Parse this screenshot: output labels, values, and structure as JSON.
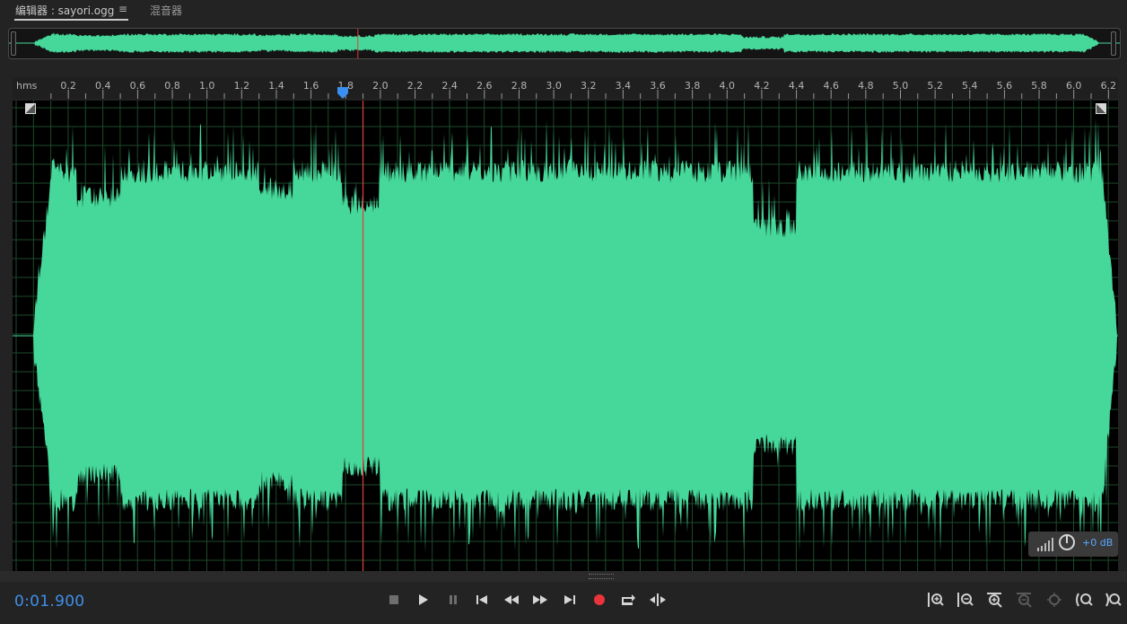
{
  "tabs": [
    {
      "label": "编辑器 : sayori.ogg",
      "active": true
    },
    {
      "label": "混音器",
      "active": false
    }
  ],
  "menu_icon": "hamburger-menu-icon",
  "ruler": {
    "unit_label": "hms",
    "ticks": [
      "0.2",
      "0.4",
      "0.6",
      "0.8",
      "1.0",
      "1.2",
      "1.4",
      "1.6",
      "1.8",
      "2.0",
      "2.2",
      "2.4",
      "2.6",
      "2.8",
      "3.0",
      "3.2",
      "3.4",
      "3.6",
      "3.8",
      "4.0",
      "4.2",
      "4.4",
      "4.6",
      "4.8",
      "5.0",
      "5.2",
      "5.4",
      "5.6",
      "5.8",
      "6.0",
      "6.2"
    ]
  },
  "waveform": {
    "color": "#46d89a",
    "playhead_color": "#e23b3b",
    "grid_color": "#1e4a2a",
    "duration_seconds": 6.3,
    "playhead_seconds": 1.9
  },
  "gain": {
    "label": "+0 dB",
    "icons": [
      "level-bars-icon",
      "gain-knob-icon"
    ]
  },
  "transport": {
    "timecode": "0:01.900",
    "buttons": [
      {
        "name": "stop-button",
        "icon": "stop-icon"
      },
      {
        "name": "play-button",
        "icon": "play-icon"
      },
      {
        "name": "pause-button",
        "icon": "pause-icon"
      },
      {
        "name": "skip-to-start-button",
        "icon": "skip-start-icon"
      },
      {
        "name": "rewind-button",
        "icon": "rewind-icon"
      },
      {
        "name": "fast-forward-button",
        "icon": "fast-forward-icon"
      },
      {
        "name": "skip-to-end-button",
        "icon": "skip-end-icon"
      },
      {
        "name": "record-button",
        "icon": "record-icon"
      },
      {
        "name": "loop-button",
        "icon": "loop-icon"
      },
      {
        "name": "skip-selection-button",
        "icon": "skip-selection-icon"
      }
    ],
    "zoom_buttons": [
      {
        "name": "zoom-in-amplitude-button",
        "icon": "zoom-in-amplitude-icon"
      },
      {
        "name": "zoom-out-amplitude-button",
        "icon": "zoom-out-amplitude-icon"
      },
      {
        "name": "zoom-in-time-button",
        "icon": "zoom-in-time-icon"
      },
      {
        "name": "zoom-out-time-button",
        "icon": "zoom-out-time-icon"
      },
      {
        "name": "zoom-to-selection-button",
        "icon": "zoom-selection-icon"
      },
      {
        "name": "zoom-in-left-button",
        "icon": "zoom-in-left-icon"
      },
      {
        "name": "zoom-in-right-button",
        "icon": "zoom-in-right-icon"
      }
    ]
  }
}
